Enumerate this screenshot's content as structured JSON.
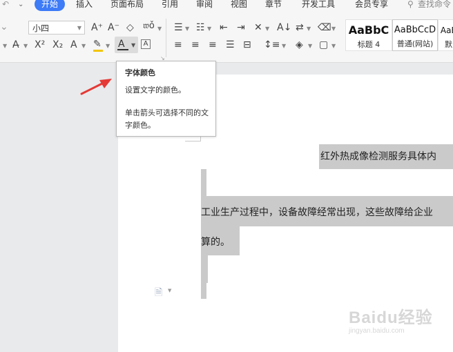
{
  "menu": {
    "start_tab": "开始",
    "items": [
      "插入",
      "页面布局",
      "引用",
      "审阅",
      "视图",
      "章节",
      "开发工具",
      "会员专享"
    ],
    "search_placeholder": "查找命令"
  },
  "ribbon": {
    "font_size": "小四",
    "styles": [
      {
        "sample": "AaBbC",
        "label": "标题 4"
      },
      {
        "sample": "AaBbCcD",
        "label": "普通(网站)"
      },
      {
        "sample": "AaE",
        "label": "默"
      }
    ]
  },
  "tooltip": {
    "title": "字体颜色",
    "description": "设置文字的颜色。",
    "hint": "单击箭头可选择不同的文字颜色。"
  },
  "document": {
    "heading": "红外热成像检测服务具体内",
    "paragraph_line1": "工业生产过程中，设备故障经常出现，这些故障给企业",
    "paragraph_line2": "算的。"
  },
  "watermark": {
    "brand": "Baidu经验",
    "url": "jingyan.baidu.com"
  },
  "colors": {
    "accent": "#3d7bf7",
    "selection": "#cacaca",
    "arrow": "#e53935",
    "highlight": "#f2c500"
  }
}
